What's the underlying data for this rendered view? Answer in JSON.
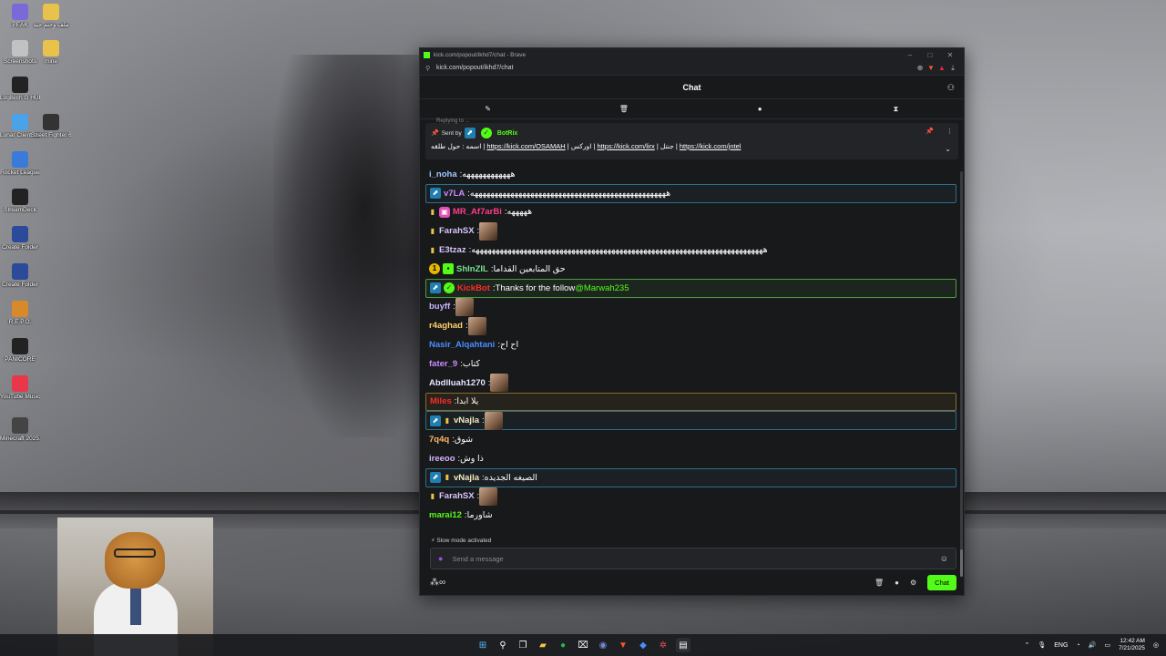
{
  "desktop_icons": [
    {
      "label": "PEAK",
      "color": "#7a6ad8"
    },
    {
      "label": "ملف وحتم\nجيد",
      "color": "#e8c24a"
    },
    {
      "label": "Screenshots",
      "color": "#c2c2c2"
    },
    {
      "label": "mine",
      "color": "#e8c24a"
    },
    {
      "label": "Logitech G\nHUB",
      "color": "#222"
    },
    {
      "label": "Lunar Client\nLauncher",
      "color": "#4aa3e8"
    },
    {
      "label": "Street\nFighter 6",
      "color": "#333"
    },
    {
      "label": "Rocket\nLeague",
      "color": "#3a7ad8"
    },
    {
      "label": "StreamDeck",
      "color": "#222"
    },
    {
      "label": "Create Folder",
      "color": "#2b4a9a"
    },
    {
      "label": "Create Folder",
      "color": "#2b4a9a"
    },
    {
      "label": "R.E.P.O.",
      "color": "#d88a2b"
    },
    {
      "label": "PANICORE",
      "color": "#222"
    },
    {
      "label": "YouTube\nMusic Des...",
      "color": "#e8374a"
    },
    {
      "label": "Minecraft\n2025.07.15 -...",
      "color": "#444"
    }
  ],
  "browser": {
    "title": "kick.com/popout/ikhd7/chat - Brave",
    "url": "kick.com/popout/ikhd7/chat"
  },
  "chat": {
    "header_title": "Chat",
    "tabs": [
      "pin-icon",
      "trash-icon",
      "chat-bubble-icon",
      "hourglass-icon"
    ],
    "pinned": {
      "reply_hint": "Replying to ...",
      "sent_by_label": "Sent by",
      "bot_name": "BotRix",
      "message_prefix": "اسمه : حول طلقه",
      "links": [
        "https://kick.com/OSAMAH",
        "https://kick.com/lirx",
        "https://kick.com/jntel"
      ],
      "link_labels": [
        "| اوركس",
        "| جنتل"
      ]
    },
    "messages": [
      {
        "user": "i_noha",
        "color": "#9fc8ff",
        "text": "ههههههههههههه",
        "badges": [],
        "hl": ""
      },
      {
        "user": "v7LA",
        "color": "#c98bff",
        "text": "هههههههههههههههههههههههههههههههههههههههههههههههههه",
        "badges": [
          "vip"
        ],
        "hl": "hl-blue"
      },
      {
        "user": "MR_Af7arBi",
        "color": "#ff3e8a",
        "text": "هههههه",
        "badges": [
          "sub",
          "gift"
        ],
        "hl": ""
      },
      {
        "user": "FarahSX",
        "color": "#d9c7ff",
        "text": "",
        "emote": true,
        "badges": [
          "sub"
        ],
        "hl": ""
      },
      {
        "user": "E3tzaz",
        "color": "#d9c7ff",
        "text": "هههههههههههههههههههههههههههههههههههههههههههههههههههههههههههههههههههههههههه",
        "badges": [
          "sub"
        ],
        "hl": ""
      },
      {
        "user": "ShInZIL",
        "color": "#78e08f",
        "text": "حق المتابعين القداما",
        "badges": [
          "num",
          "green"
        ],
        "hl": ""
      },
      {
        "user": "KickBot",
        "color": "#ff2a2a",
        "text": "Thanks for the follow ",
        "mention": "@Marwah235",
        "badges": [
          "vip",
          "verified"
        ],
        "hl": "hl-green"
      },
      {
        "user": "buyff",
        "color": "#c9b3ff",
        "text": "",
        "emote": true,
        "badges": [],
        "hl": ""
      },
      {
        "user": "r4aghad",
        "color": "#ffcf66",
        "text": "",
        "emote": true,
        "badges": [],
        "hl": ""
      },
      {
        "user": "Nasir_Alqahtani",
        "color": "#4a8dff",
        "text": "اح اح",
        "badges": [],
        "hl": ""
      },
      {
        "user": "fater_9",
        "color": "#c98bff",
        "text": "كتاب",
        "badges": [],
        "hl": ""
      },
      {
        "user": "Abdlluah1270",
        "color": "#e6e6ff",
        "text": "",
        "emote": true,
        "badges": [],
        "hl": ""
      },
      {
        "user": "Miles",
        "color": "#ff2a2a",
        "text": "يلا ابدا",
        "badges": [],
        "hl": "hl-orange"
      },
      {
        "user": "vNajla",
        "color": "#f3e9c0",
        "text": "",
        "emote": true,
        "badges": [
          "vip",
          "sub"
        ],
        "hl": "hl-blue"
      },
      {
        "user": "7q4q",
        "color": "#ffb86b",
        "text": "شوق",
        "badges": [],
        "hl": ""
      },
      {
        "user": "ireeoo",
        "color": "#d9b3ff",
        "text": "ذا وش",
        "badges": [],
        "hl": ""
      },
      {
        "user": "vNajla",
        "color": "#f3e9c0",
        "text": "الصيغه الجديده",
        "badges": [
          "vip",
          "sub"
        ],
        "hl": "hl-blue"
      },
      {
        "user": "FarahSX",
        "color": "#d9c7ff",
        "text": "",
        "emote": true,
        "badges": [
          "sub"
        ],
        "hl": ""
      },
      {
        "user": "marai12",
        "color": "#53fc18",
        "text": "شاورما",
        "badges": [],
        "hl": ""
      }
    ],
    "slow_mode": "Slow mode activated",
    "input_placeholder": "Send a message",
    "chat_button": "Chat",
    "accent": "#53fc18"
  },
  "taskbar": {
    "lang": "ENG",
    "time": "12:42 AM",
    "date": "7/21/2025"
  }
}
